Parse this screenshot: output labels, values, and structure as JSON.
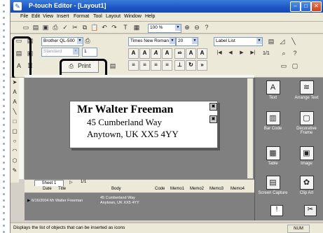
{
  "window": {
    "title": "P-touch Editor - [Layout1]"
  },
  "menu": [
    "File",
    "Edit",
    "View",
    "Insert",
    "Format",
    "Tool",
    "Layout",
    "Window",
    "Help"
  ],
  "toolbar": {
    "zoom": "100 %",
    "font_name": "Times New Roman",
    "font_size": "20",
    "label_list": "Label List",
    "printer": "Brother QL-500",
    "paper": "Standard",
    "copies": "1",
    "print_label": "Print",
    "page_counter": "1/1"
  },
  "label": {
    "line1": "Mr Walter Freeman",
    "line2": "45 Cumberland Way",
    "line3": "Anytown, UK XX5 4YY"
  },
  "sheet": {
    "tab": "Sheet 1",
    "counter": "1/1"
  },
  "objects": [
    "Text",
    "Arrange Text",
    "Bar Code",
    "Decorative Frame",
    "Table",
    "Image",
    "Screen Capture",
    "Clip Art"
  ],
  "grid": {
    "columns": [
      "Date",
      "Title",
      "Body",
      "Code",
      "Memo1",
      "Memo2",
      "Memo3",
      "Memo4"
    ],
    "row": {
      "date": "6/16/2004",
      "title": "Mr Walter Freeman",
      "body1": "45 Cumberland Way",
      "body2": "Anytown, UK XX5 4YY"
    }
  },
  "status": {
    "text": "Displays the list of objects that can be inserted as icons",
    "num": "NUM"
  }
}
